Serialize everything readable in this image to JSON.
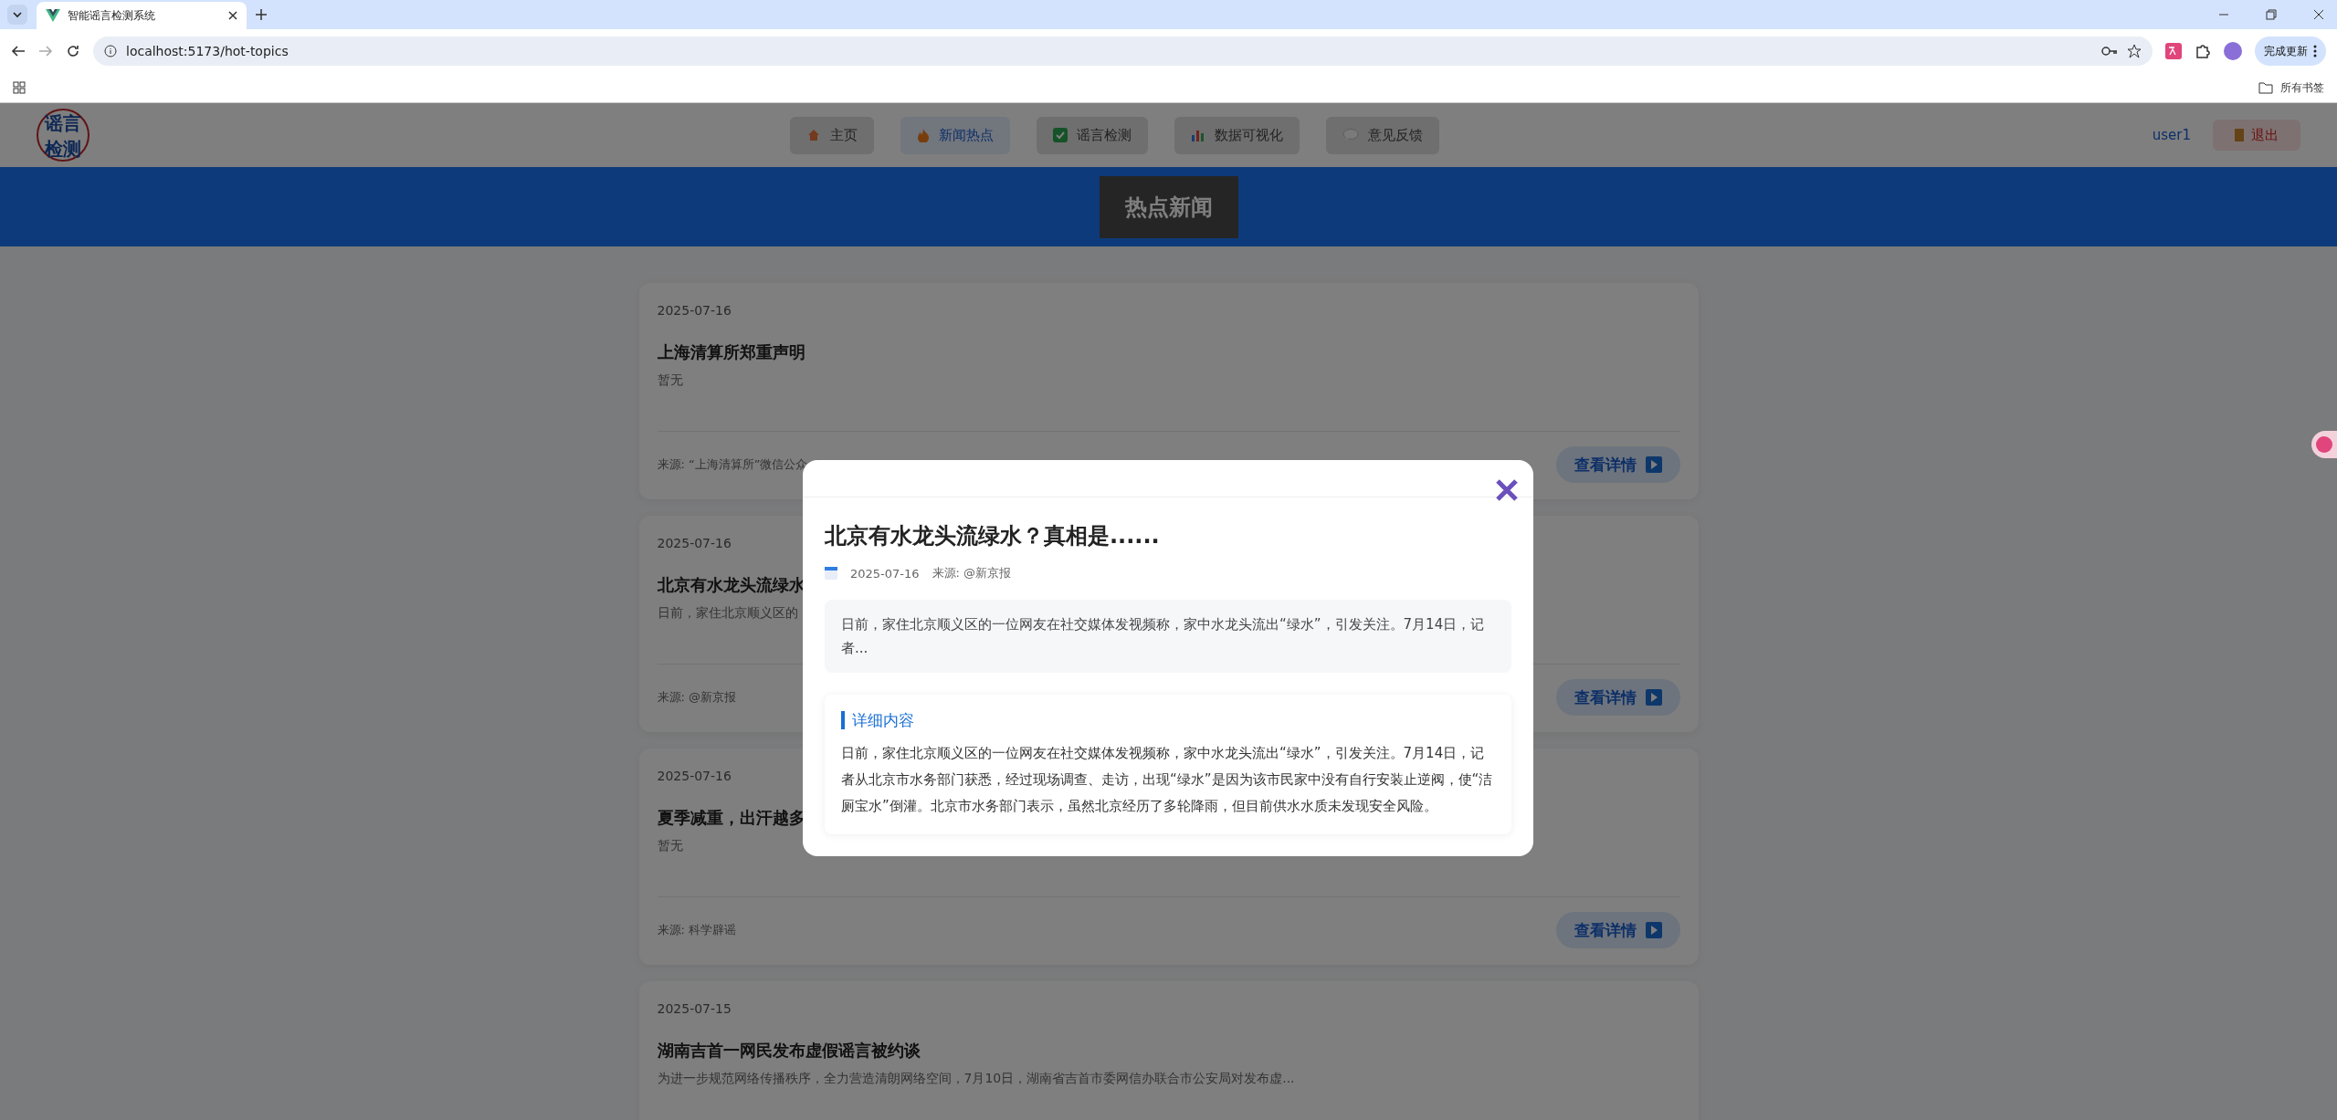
{
  "browser": {
    "tab_title": "智能谣言检测系统",
    "address": "localhost:5173/hot-topics",
    "update_button": "完成更新",
    "bookmarks_label": "所有书签"
  },
  "header": {
    "logo_lines": [
      "谣言",
      "检测"
    ],
    "nav": [
      {
        "label": "主页",
        "selected": false
      },
      {
        "label": "新闻热点",
        "selected": true
      },
      {
        "label": "谣言检测",
        "selected": false
      },
      {
        "label": "数据可视化",
        "selected": false
      },
      {
        "label": "意见反馈",
        "selected": false
      }
    ],
    "user": "user1",
    "logout": "退出"
  },
  "banner": {
    "title": "热点新闻"
  },
  "news": [
    {
      "date": "2025-07-16",
      "title": "上海清算所郑重声明",
      "summary": "暂无",
      "source": "来源: “上海清算所”微信公众",
      "button": "查看详情"
    },
    {
      "date": "2025-07-16",
      "title": "北京有水龙头流绿水",
      "summary": "日前，家住北京顺义区的",
      "source": "来源: @新京报",
      "button": "查看详情"
    },
    {
      "date": "2025-07-16",
      "title": "夏季减重，出汗越多",
      "summary": "暂无",
      "source": "来源: 科学辟谣",
      "button": "查看详情"
    },
    {
      "date": "2025-07-15",
      "title": "湖南吉首一网民发布虚假谣言被约谈",
      "summary": "为进一步规范网络传播秩序，全力营造清朗网络空间，7月10日，湖南省吉首市委网信办联合市公安局对发布虚..."
    }
  ],
  "modal": {
    "title": "北京有水龙头流绿水？真相是......",
    "date": "2025-07-16",
    "source": "来源: @新京报",
    "summary": "日前，家住北京顺义区的一位网友在社交媒体发视频称，家中水龙头流出“绿水”，引发关注。7月14日，记者...",
    "section_title": "详细内容",
    "detail": "日前，家住北京顺义区的一位网友在社交媒体发视频称，家中水龙头流出“绿水”，引发关注。7月14日，记者从北京市水务部门获悉，经过现场调查、走访，出现“绿水”是因为该市民家中没有自行安装止逆阀，使“洁厕宝水”倒灌。北京市水务部门表示，虽然北京经历了多轮降雨，但目前供水水质未发现安全风险。"
  }
}
